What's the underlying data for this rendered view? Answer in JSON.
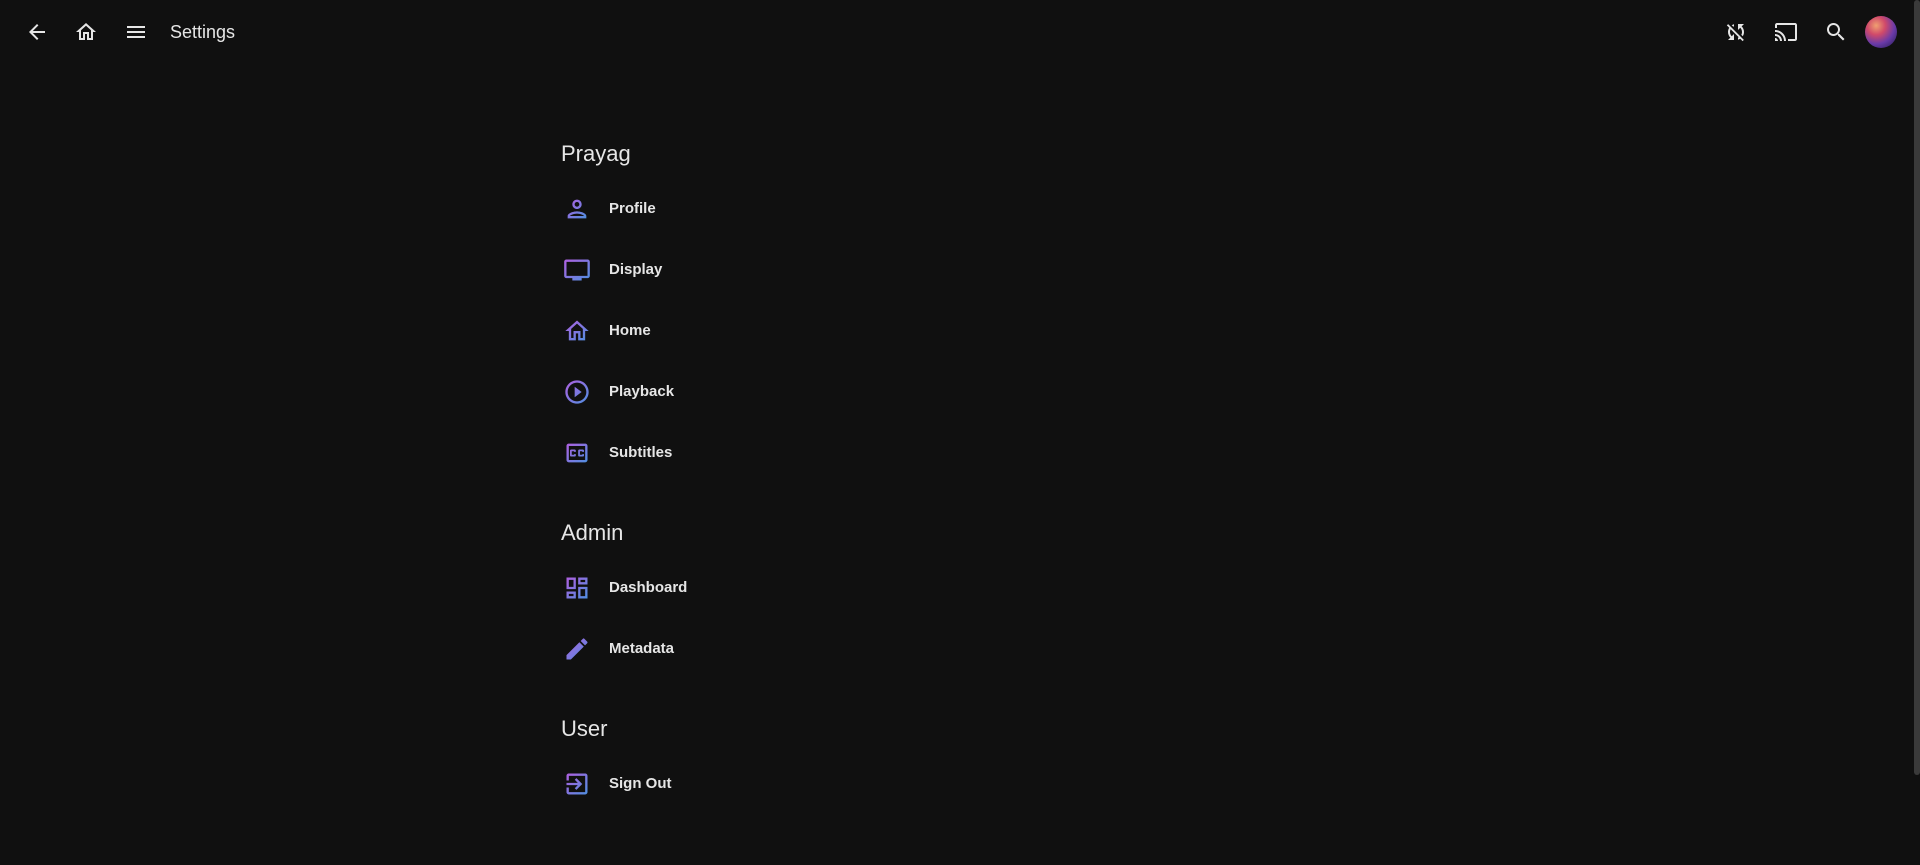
{
  "header": {
    "title": "Settings"
  },
  "sections": [
    {
      "title": "Prayag",
      "items": [
        {
          "label": "Profile"
        },
        {
          "label": "Display"
        },
        {
          "label": "Home"
        },
        {
          "label": "Playback"
        },
        {
          "label": "Subtitles"
        }
      ]
    },
    {
      "title": "Admin",
      "items": [
        {
          "label": "Dashboard"
        },
        {
          "label": "Metadata"
        }
      ]
    },
    {
      "title": "User",
      "items": [
        {
          "label": "Sign Out"
        }
      ]
    }
  ],
  "colors": {
    "background": "#101010",
    "text": "#e6e6e6",
    "icon_gradient_start": "#a55fe0",
    "icon_gradient_end": "#4f8fe0"
  }
}
